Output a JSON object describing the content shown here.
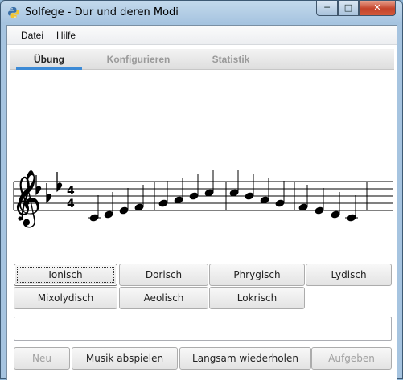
{
  "window": {
    "title": "Solfege - Dur und deren Modi",
    "min_label": "─",
    "max_label": "□",
    "close_label": "✕"
  },
  "menu": {
    "items": [
      "Datei",
      "Hilfe"
    ]
  },
  "tabs": [
    {
      "label": "Übung",
      "active": true
    },
    {
      "label": "Konfigurieren",
      "active": false
    },
    {
      "label": "Statistik",
      "active": false
    }
  ],
  "staff": {
    "clef": "treble-clef",
    "key_signature": "3 flats",
    "time_signature": [
      "4",
      "4"
    ]
  },
  "mode_buttons": [
    "Ionisch",
    "Dorisch",
    "Phrygisch",
    "Lydisch",
    "Mixolydisch",
    "Aeolisch",
    "Lokrisch"
  ],
  "answer": {
    "value": ""
  },
  "actions": {
    "new_label": "Neu",
    "play_label": "Musik abspielen",
    "slow_label": "Langsam wiederholen",
    "give_up_label": "Aufgeben"
  },
  "icons": {
    "app": "python-icon"
  },
  "colors": {
    "accent": "#3c8ad6",
    "close": "#c4432a"
  }
}
